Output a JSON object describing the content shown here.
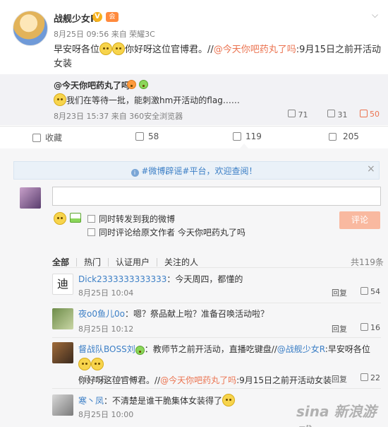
{
  "post": {
    "author": "战舰少女R",
    "verified_badge": "V",
    "member_badge": "会",
    "meta": "8月25日 09:56 来自 荣耀3C",
    "text_a": "早安呀各位",
    "text_b": "你好呀这位官博君。//",
    "text_mention": "@今天你吧药丸了吗",
    "text_c": ":9月15日之前开活动",
    "text_d": "女装"
  },
  "repost": {
    "author": "@今天你吧药丸了吗",
    "text": "我们在等待一批，能刺激hm开活动的flag……",
    "meta": "8月23日 15:37 来自 360安全浏览器",
    "reposts": "71",
    "comments": "31",
    "likes": "50"
  },
  "toolbar": {
    "favorite": "收藏",
    "repost_count": "58",
    "comment_count": "119",
    "like_count": "205"
  },
  "notice": {
    "text": "#微博辟谣#平台，欢迎查阅！",
    "close": "×"
  },
  "composer": {
    "placeholder": "",
    "option_repost": "同时转发到我的微博",
    "option_comment": "同时评论给原文作者 今天你吧药丸了吗",
    "submit": "评论"
  },
  "comment_tabs": {
    "items": [
      "全部",
      "热门",
      "认证用户",
      "关注的人"
    ],
    "total": "共119条"
  },
  "comments": [
    {
      "user": "Dick2333333333333",
      "text": "：今天周四，都懂的",
      "time": "8月25日 10:04",
      "reply": "回复",
      "likes": "54"
    },
    {
      "user": "夜o0鱼儿0o",
      "text": "：嗯？祭品献上啦？准备召唤活动啦？",
      "time": "8月25日 10:12",
      "reply": "回复",
      "likes": "16"
    },
    {
      "user": "督战队BOSS刘",
      "text_a": "：教师节之前开活动，直播吃键盘//",
      "mention_a": "@战舰少女R",
      "text_b": ":早安呀各位",
      "text_c": "你好呀这位官博君。//",
      "mention_b": "@今天你吧药丸了吗",
      "text_d": ":9月15日之前开活动女装",
      "time": "8月25日 10:54",
      "reply": "回复",
      "likes": "22"
    },
    {
      "user": "寒丶凤",
      "text": "：不清楚是谁干脆集体女装得了",
      "time": "8月25日 10:00"
    }
  ],
  "watermark": "sina 新浪游戏"
}
